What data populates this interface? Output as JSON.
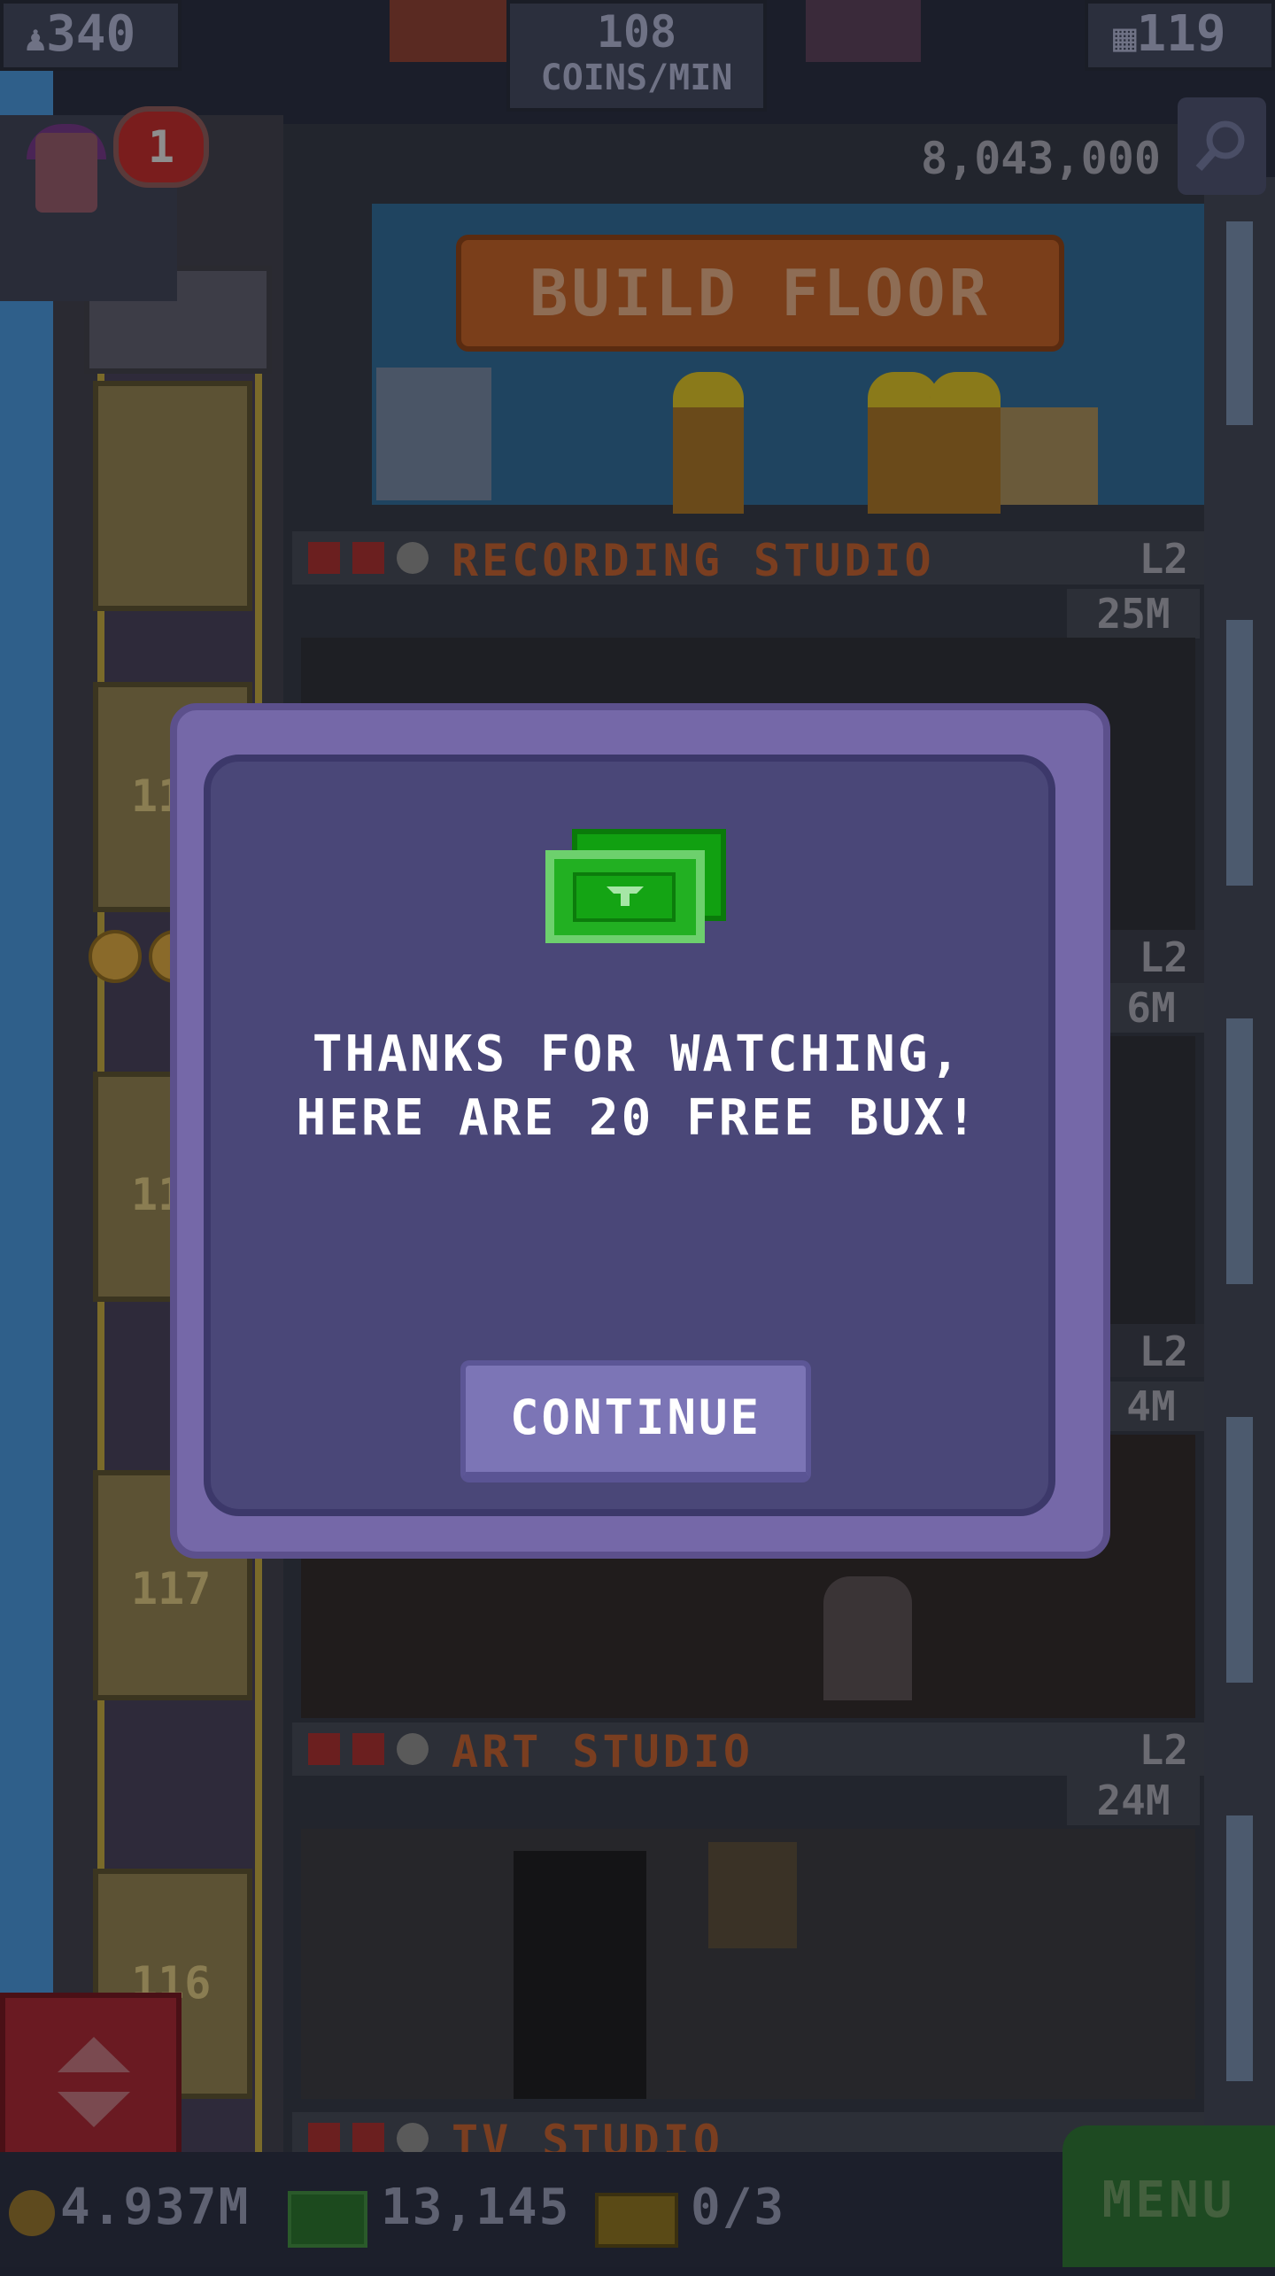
{
  "top_bar": {
    "population": "340",
    "coins_per_min_value": "108",
    "coins_per_min_unit": "COINS/MIN",
    "floors": "119"
  },
  "notification_count": "1",
  "build_floor": {
    "cost": "8,043,000",
    "label": "BUILD FLOOR"
  },
  "floors": [
    {
      "name": "RECORDING STUDIO",
      "level": "L2",
      "value": "25M"
    },
    {
      "name": "",
      "level": "L2",
      "value": "6M"
    },
    {
      "name": "",
      "level": "L2",
      "value": "4M"
    },
    {
      "name": "ART STUDIO",
      "level": "L2",
      "value": "24M"
    },
    {
      "name": "TV STUDIO",
      "level": "",
      "value": ""
    }
  ],
  "shaft_numbers": [
    "11",
    "11",
    "117",
    "116"
  ],
  "bottom_bar": {
    "coins": "4.937M",
    "bux": "13,145",
    "tickets": "0/3",
    "menu": "MENU"
  },
  "dialog": {
    "message_line1": "THANKS FOR WATCHING,",
    "message_line2": "HERE ARE 20 FREE BUX!",
    "button": "CONTINUE"
  },
  "colors": {
    "dialog_outer": "#7568a8",
    "dialog_inner": "#4a4778",
    "button": "#7c75b6",
    "bux_green": "#22b022"
  }
}
